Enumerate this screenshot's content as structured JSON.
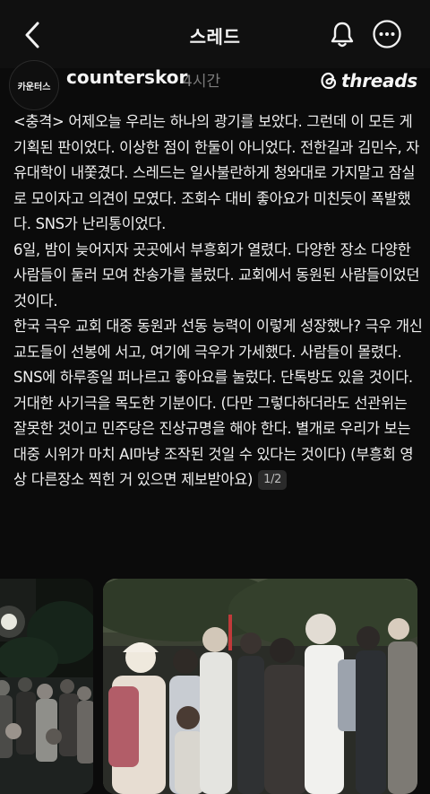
{
  "header": {
    "title": "스레드",
    "back_icon": "chevron-left-icon",
    "notification_icon": "bell-icon",
    "more_icon": "more-horizontal-icon"
  },
  "post": {
    "avatar_label": "카운터스",
    "username": "counterskor",
    "time_ago": "4시간",
    "brand": "threads",
    "paragraphs": [
      "<충격> 어제오늘 우리는 하나의 광기를 보았다. 그런데 이 모든 게 기획된 판이었다. 이상한 점이 한둘이 아니었다. 전한길과 김민수, 자유대학이 내쫓겼다. 스레드는 일사불란하게 청와대로 가지말고 잠실로 모이자고 의견이 모였다. 조회수 대비 좋아요가 미친듯이 폭발했다. SNS가 난리통이었다.",
      "6일, 밤이 늦어지자 곳곳에서 부흥회가 열렸다. 다양한 장소 다양한 사람들이 둘러 모여 찬송가를 불렀다. 교회에서 동원된 사람들이었던 것이다.",
      "한국 극우 교회 대중 동원과 선동 능력이 이렇게 성장했나? 극우 개신교도들이 선봉에 서고, 여기에 극우가 가세했다. 사람들이 몰렸다. SNS에 하루종일 퍼나르고 좋아요를 눌렀다. 단톡방도 있을 것이다. 거대한 사기극을 목도한 기분이다. (다만 그렇다하더라도 선관위는 잘못한 것이고 민주당은 진상규명을 해야 한다. 별개로 우리가 보는 대중 시위가 마치 AI마냥 조작된 것일 수 있다는 것이다) (부흥회 영상 다른장소 찍힌 거 있으면 제보받아요)"
    ],
    "page_indicator": "1/2"
  },
  "colors": {
    "background": "#0b0b0b",
    "text": "#f0f0f0",
    "muted": "#7b7b7b",
    "badge_bg": "#2a2a2a"
  }
}
